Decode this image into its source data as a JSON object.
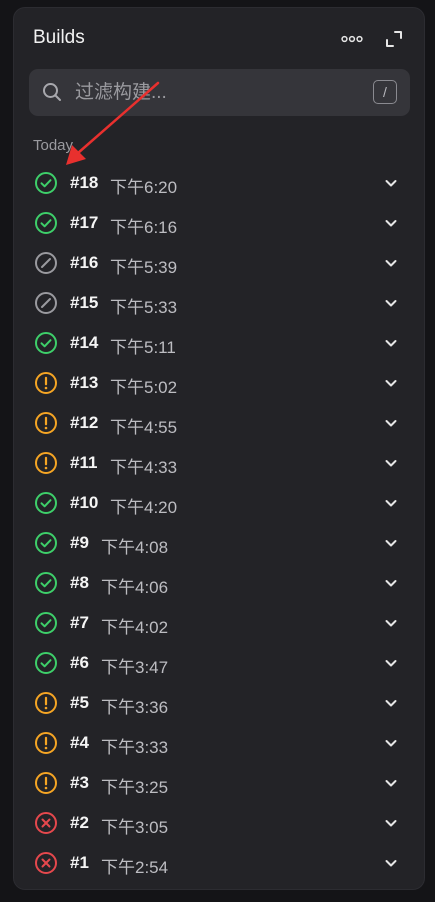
{
  "header": {
    "title": "Builds"
  },
  "search": {
    "placeholder": "过滤构建...",
    "shortcut": "/"
  },
  "section": {
    "label": "Today"
  },
  "colors": {
    "success": "#3ecf6a",
    "warning": "#f5a524",
    "failed": "#e5484d",
    "cancelled": "#9a9a9f",
    "annotation": "#e8302e"
  },
  "builds": [
    {
      "number": "#18",
      "time": "下午6:20",
      "status": "success"
    },
    {
      "number": "#17",
      "time": "下午6:16",
      "status": "success"
    },
    {
      "number": "#16",
      "time": "下午5:39",
      "status": "cancelled"
    },
    {
      "number": "#15",
      "time": "下午5:33",
      "status": "cancelled"
    },
    {
      "number": "#14",
      "time": "下午5:11",
      "status": "success"
    },
    {
      "number": "#13",
      "time": "下午5:02",
      "status": "warning"
    },
    {
      "number": "#12",
      "time": "下午4:55",
      "status": "warning"
    },
    {
      "number": "#11",
      "time": "下午4:33",
      "status": "warning"
    },
    {
      "number": "#10",
      "time": "下午4:20",
      "status": "success"
    },
    {
      "number": "#9",
      "time": "下午4:08",
      "status": "success"
    },
    {
      "number": "#8",
      "time": "下午4:06",
      "status": "success"
    },
    {
      "number": "#7",
      "time": "下午4:02",
      "status": "success"
    },
    {
      "number": "#6",
      "time": "下午3:47",
      "status": "success"
    },
    {
      "number": "#5",
      "time": "下午3:36",
      "status": "warning"
    },
    {
      "number": "#4",
      "time": "下午3:33",
      "status": "warning"
    },
    {
      "number": "#3",
      "time": "下午3:25",
      "status": "warning"
    },
    {
      "number": "#2",
      "time": "下午3:05",
      "status": "failed"
    },
    {
      "number": "#1",
      "time": "下午2:54",
      "status": "failed"
    }
  ]
}
